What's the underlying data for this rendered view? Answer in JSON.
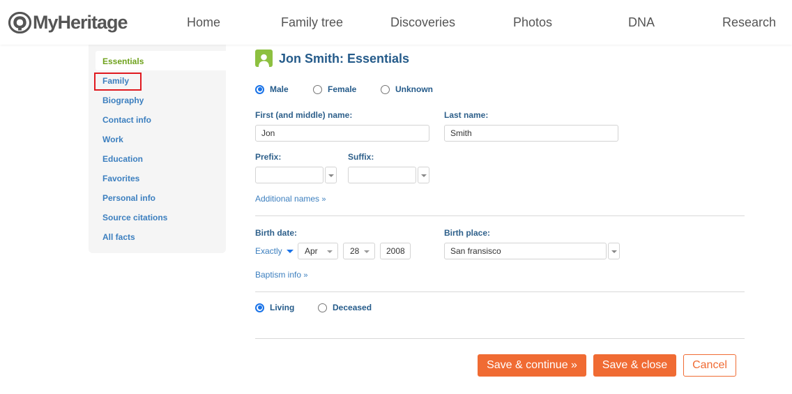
{
  "brand": {
    "name": "MyHeritage",
    "accent_color": "#f06b33",
    "green_color": "#8dc040",
    "link_color": "#3c7fbf"
  },
  "nav": {
    "items": [
      {
        "label": "Home"
      },
      {
        "label": "Family tree"
      },
      {
        "label": "Discoveries"
      },
      {
        "label": "Photos"
      },
      {
        "label": "DNA"
      },
      {
        "label": "Research"
      }
    ]
  },
  "sidebar": {
    "active": "Essentials",
    "highlighted": "Family",
    "items": [
      {
        "label": "Essentials"
      },
      {
        "label": "Family"
      },
      {
        "label": "Biography"
      },
      {
        "label": "Contact info"
      },
      {
        "label": "Work"
      },
      {
        "label": "Education"
      },
      {
        "label": "Favorites"
      },
      {
        "label": "Personal info"
      },
      {
        "label": "Source citations"
      },
      {
        "label": "All facts"
      }
    ]
  },
  "form": {
    "title": "Jon Smith: Essentials",
    "profile_icon": "person-icon",
    "gender": {
      "selected": "Male",
      "options": [
        {
          "label": "Male",
          "checked": true
        },
        {
          "label": "Female",
          "checked": false
        },
        {
          "label": "Unknown",
          "checked": false
        }
      ]
    },
    "first_name": {
      "label": "First (and middle) name:",
      "value": "Jon"
    },
    "last_name": {
      "label": "Last name:",
      "value": "Smith"
    },
    "prefix": {
      "label": "Prefix:",
      "value": ""
    },
    "suffix": {
      "label": "Suffix:",
      "value": ""
    },
    "additional_names_link": "Additional names",
    "raquo": "»",
    "birth_date": {
      "label": "Birth date:",
      "qualifier": "Exactly",
      "month": "Apr",
      "day": "28",
      "year": "2008"
    },
    "birth_place": {
      "label": "Birth place:",
      "value": "San fransisco"
    },
    "baptism_link": "Baptism info",
    "status": {
      "selected": "Living",
      "options": [
        {
          "label": "Living",
          "checked": true
        },
        {
          "label": "Deceased",
          "checked": false
        }
      ]
    }
  },
  "actions": {
    "save_continue": "Save & continue »",
    "save_close": "Save & close",
    "cancel": "Cancel"
  }
}
